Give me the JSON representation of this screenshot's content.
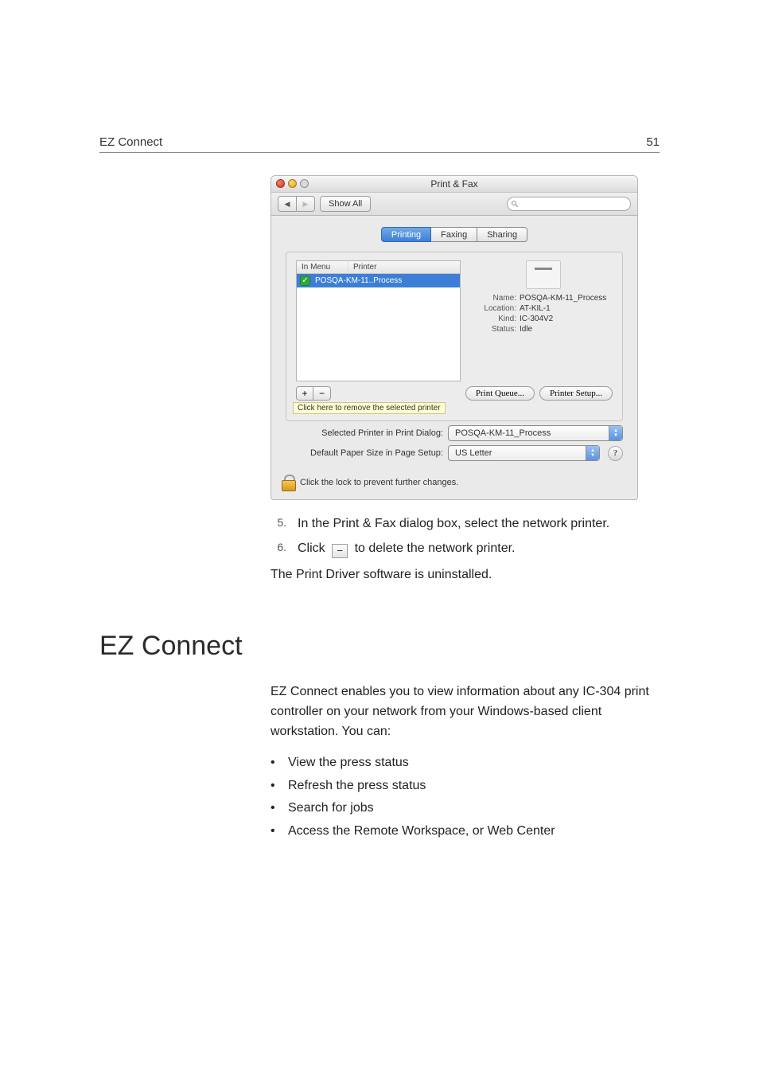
{
  "page": {
    "running_title": "EZ Connect",
    "number": "51"
  },
  "mac": {
    "window_title": "Print & Fax",
    "showall": "Show All",
    "tabs": {
      "printing": "Printing",
      "faxing": "Faxing",
      "sharing": "Sharing"
    },
    "list": {
      "col_menu": "In Menu",
      "col_printer": "Printer",
      "row_name": "POSQA-KM-11..Process"
    },
    "details": {
      "labels": {
        "name": "Name:",
        "location": "Location:",
        "kind": "Kind:",
        "status": "Status:"
      },
      "values": {
        "name": "POSQA-KM-11_Process",
        "location": "AT-KIL-1",
        "kind": "IC-304V2",
        "status": "Idle"
      }
    },
    "buttons": {
      "queue": "Print Queue...",
      "setup": "Printer Setup..."
    },
    "tooltip": "Click here to remove the selected printer",
    "row1_label": "Selected Printer in Print Dialog:",
    "row1_value": "POSQA-KM-11_Process",
    "row2_label": "Default Paper Size in Page Setup:",
    "row2_value": "US Letter",
    "lock_text": "Click the lock to prevent further changes.",
    "help": "?"
  },
  "steps": {
    "n5": "5.",
    "t5": "In the Print & Fax dialog box, select the network printer.",
    "n6": "6.",
    "t6a": "Click",
    "t6b": "to delete the network printer."
  },
  "after_steps": "The Print Driver software is uninstalled.",
  "section_heading": "EZ Connect",
  "intro": "EZ Connect enables you to view information about any IC-304 print controller on your network from your Windows-based client workstation. You can:",
  "bullets": [
    "View the press status",
    "Refresh the press status",
    "Search for jobs",
    "Access the Remote Workspace, or Web Center"
  ]
}
